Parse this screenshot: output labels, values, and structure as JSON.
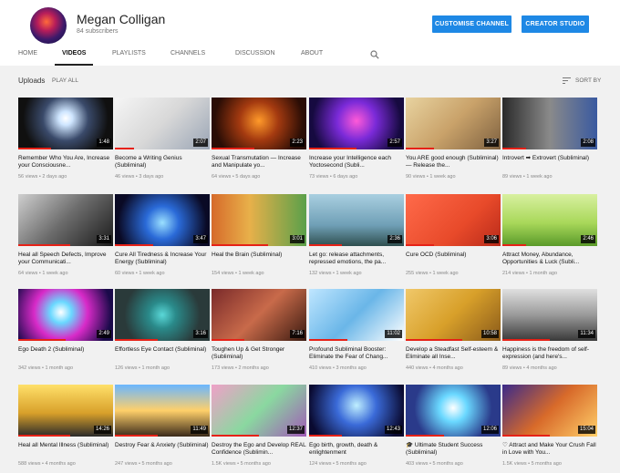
{
  "channel": {
    "name": "Megan Colligan",
    "subscribers": "84 subscribers",
    "customise_label": "CUSTOMISE CHANNEL",
    "studio_label": "CREATOR STUDIO"
  },
  "tabs": [
    "HOME",
    "VIDEOS",
    "PLAYLISTS",
    "CHANNELS",
    "DISCUSSION",
    "ABOUT"
  ],
  "active_tab": "VIDEOS",
  "uploads": {
    "label": "Uploads",
    "play_all": "PLAY ALL",
    "sort_label": "SORT BY"
  },
  "colors": {
    "accent": "#1e88e5",
    "progress": "#e62117"
  },
  "videos": [
    {
      "title": "Remember Who You Are, Increase your Consciousne...",
      "views": "56 views",
      "age": "2 days ago",
      "duration": "1:48"
    },
    {
      "title": "Become a Writing Genius (Subliminal)",
      "views": "46 views",
      "age": "3 days ago",
      "duration": "2:07"
    },
    {
      "title": "Sexual Transmutation — Increase and Manipulate yo...",
      "views": "64 views",
      "age": "5 days ago",
      "duration": "2:23"
    },
    {
      "title": "Increase your Intelligence each Yoctosecond (Subli...",
      "views": "73 views",
      "age": "6 days ago",
      "duration": "2:57"
    },
    {
      "title": "You ARE good enough (Subliminal) — Release the...",
      "views": "90 views",
      "age": "1 week ago",
      "duration": "3:27"
    },
    {
      "title": "Introvert ➡ Extrovert (Subliminal)",
      "views": "89 views",
      "age": "1 week ago",
      "duration": "2:08"
    },
    {
      "title": "Heal all Speech Defects, Improve your Communicati...",
      "views": "64 views",
      "age": "1 week ago",
      "duration": "3:31"
    },
    {
      "title": "Cure All Tiredness & Increase Your Energy (Subliminal)",
      "views": "60 views",
      "age": "1 week ago",
      "duration": "3:47"
    },
    {
      "title": "Heal the Brain (Subliminal)",
      "views": "154 views",
      "age": "1 week ago",
      "duration": "3:01"
    },
    {
      "title": "Let go: release attachments, repressed emotions, the pa...",
      "views": "132 views",
      "age": "1 week ago",
      "duration": "2:36"
    },
    {
      "title": "Cure OCD (Subliminal)",
      "views": "255 views",
      "age": "1 week ago",
      "duration": "3:06"
    },
    {
      "title": "Attract Money, Abundance, Opportunities & Luck (Subli...",
      "views": "214 views",
      "age": "1 month ago",
      "duration": "2:46"
    },
    {
      "title": "Ego Death 2 (Subliminal)",
      "views": "342 views",
      "age": "1 month ago",
      "duration": "2:49"
    },
    {
      "title": "Effortless Eye Contact (Subliminal)",
      "views": "126 views",
      "age": "1 month ago",
      "duration": "3:16"
    },
    {
      "title": "Toughen Up & Get Stronger (Subliminal)",
      "views": "173 views",
      "age": "2 months ago",
      "duration": "7:16"
    },
    {
      "title": "Profound Subliminal Booster: Eliminate the Fear of Chang...",
      "views": "410 views",
      "age": "3 months ago",
      "duration": "11:02"
    },
    {
      "title": "Develop a Steadfast Self-esteem & Eliminate all Inse...",
      "views": "440 views",
      "age": "4 months ago",
      "duration": "10:58"
    },
    {
      "title": "Happiness is the freedom of self-expression (and here's...",
      "views": "89 views",
      "age": "4 months ago",
      "duration": "11:34"
    },
    {
      "title": "Heal all Mental Illness (Subliminal)",
      "views": "588 views",
      "age": "4 months ago",
      "duration": "14:26"
    },
    {
      "title": "Destroy Fear & Anxiety (Subliminal)",
      "views": "247 views",
      "age": "5 months ago",
      "duration": "11:49"
    },
    {
      "title": "Destroy the Ego and Develop REAL Confidence (Sublimin...",
      "views": "1.5K views",
      "age": "5 months ago",
      "duration": "12:37"
    },
    {
      "title": "Ego birth, growth, death & enlightenment",
      "views": "124 views",
      "age": "5 months ago",
      "duration": "12:43"
    },
    {
      "title": "🎓 Ultimate Student Success (Subliminal)",
      "views": "403 views",
      "age": "5 months ago",
      "duration": "12:06"
    },
    {
      "title": "♡ Attract and Make Your Crush Fall in Love with You...",
      "views": "1.5K views",
      "age": "5 months ago",
      "duration": "15:04"
    }
  ]
}
